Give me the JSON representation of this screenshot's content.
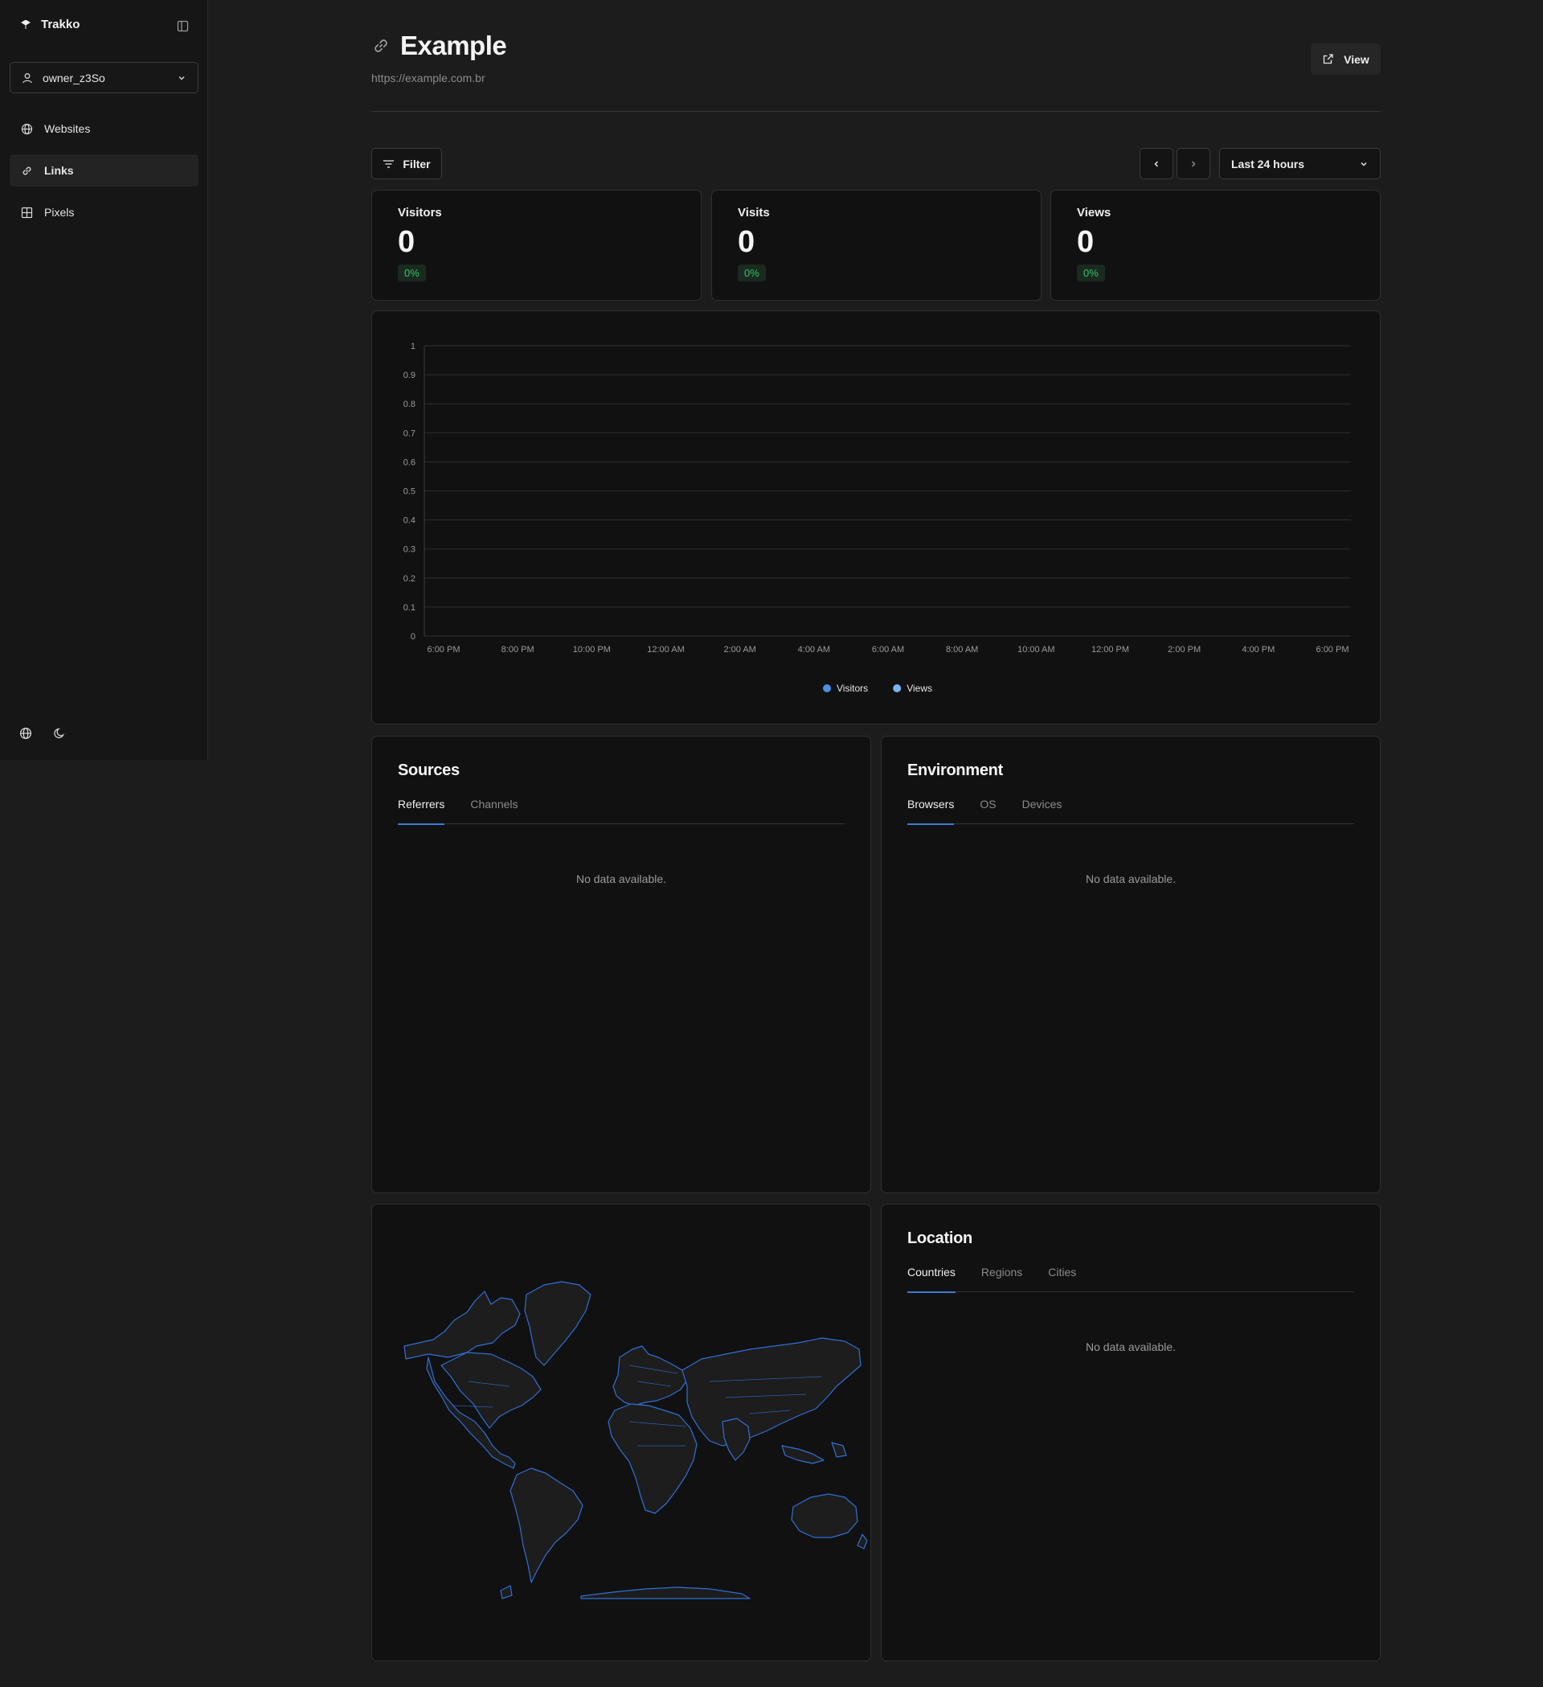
{
  "app": {
    "name": "Trakko"
  },
  "account": {
    "username": "owner_z3So"
  },
  "sidebar": {
    "items": [
      {
        "label": "Websites",
        "icon": "globe-icon",
        "active": false
      },
      {
        "label": "Links",
        "icon": "link-icon",
        "active": true
      },
      {
        "label": "Pixels",
        "icon": "grid-icon",
        "active": false
      }
    ]
  },
  "header": {
    "title": "Example",
    "url": "https://example.com.br",
    "view_label": "View"
  },
  "toolbar": {
    "filter_label": "Filter",
    "date_range": "Last 24 hours"
  },
  "metrics": [
    {
      "label": "Visitors",
      "value": "0",
      "change": "0%"
    },
    {
      "label": "Visits",
      "value": "0",
      "change": "0%"
    },
    {
      "label": "Views",
      "value": "0",
      "change": "0%"
    }
  ],
  "chart_data": {
    "type": "bar",
    "categories": [
      "6:00 PM",
      "8:00 PM",
      "10:00 PM",
      "12:00 AM",
      "2:00 AM",
      "4:00 AM",
      "6:00 AM",
      "8:00 AM",
      "10:00 AM",
      "12:00 PM",
      "2:00 PM",
      "4:00 PM",
      "6:00 PM"
    ],
    "yticks": [
      "0",
      "0.1",
      "0.2",
      "0.3",
      "0.4",
      "0.5",
      "0.6",
      "0.7",
      "0.8",
      "0.9",
      "1"
    ],
    "ylim": [
      0,
      1
    ],
    "grid": true,
    "legend_position": "bottom-center",
    "series": [
      {
        "name": "Visitors",
        "color": "#4a90e2",
        "values": [
          0,
          0,
          0,
          0,
          0,
          0,
          0,
          0,
          0,
          0,
          0,
          0,
          0
        ]
      },
      {
        "name": "Views",
        "color": "#7ab3f0",
        "values": [
          0,
          0,
          0,
          0,
          0,
          0,
          0,
          0,
          0,
          0,
          0,
          0,
          0
        ]
      }
    ]
  },
  "sources": {
    "title": "Sources",
    "tabs": [
      "Referrers",
      "Channels"
    ],
    "empty": "No data available."
  },
  "environment": {
    "title": "Environment",
    "tabs": [
      "Browsers",
      "OS",
      "Devices"
    ],
    "empty": "No data available."
  },
  "location": {
    "title": "Location",
    "tabs": [
      "Countries",
      "Regions",
      "Cities"
    ],
    "empty": "No data available."
  },
  "colors": {
    "accent": "#3a7bd5",
    "positive": "#36c26a",
    "map_stroke": "#2f6fd6"
  }
}
